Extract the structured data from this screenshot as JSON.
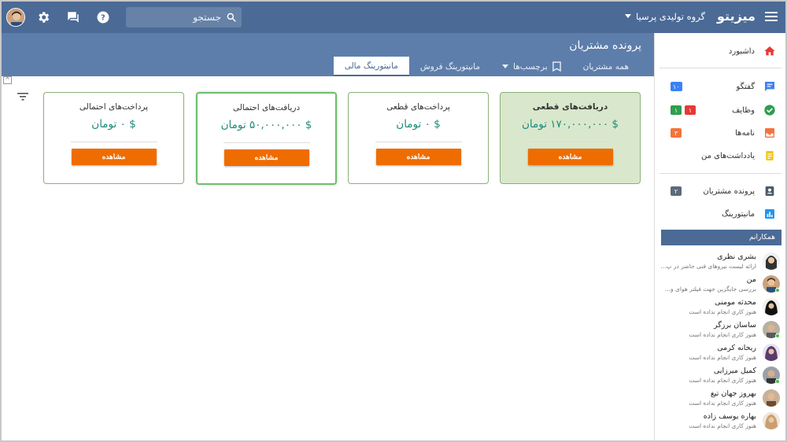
{
  "header": {
    "brand": "میزیتو",
    "org_name": "گروه تولیدی پرسیا",
    "search_placeholder": "جستجو"
  },
  "subheader": {
    "page_title": "پرونده مشتریان",
    "tabs": [
      {
        "label": "همه مشتریان"
      },
      {
        "label": "برچسب‌ها"
      },
      {
        "label": "مانیتورینگ فروش"
      },
      {
        "label": "مانیتورینگ مالی"
      }
    ]
  },
  "cards": [
    {
      "title": "دریافت‌های قطعی",
      "amount": "$ ۱۷۰,۰۰۰,۰۰۰ تومان",
      "button": "مشاهده"
    },
    {
      "title": "پرداخت‌های قطعی",
      "amount": "$ ۰ تومان",
      "button": "مشاهده"
    },
    {
      "title": "دریافت‌های احتمالی",
      "amount": "$ ۵۰,۰۰۰,۰۰۰ تومان",
      "button": "مشاهده"
    },
    {
      "title": "پرداخت‌های احتمالی",
      "amount": "$ ۰ تومان",
      "button": "مشاهده"
    }
  ],
  "sidebar": {
    "nav": [
      {
        "label": "داشبورد",
        "icon": "home-icon"
      },
      {
        "label": "گفتگو",
        "icon": "chat-icon",
        "badges": [
          {
            "text": "۱۰",
            "color": "#3b82f6"
          }
        ]
      },
      {
        "label": "وظایف",
        "icon": "check-circle-icon",
        "badges": [
          {
            "text": "۱",
            "color": "#2e9e4f"
          },
          {
            "text": "۱",
            "color": "#e53935"
          }
        ]
      },
      {
        "label": "نامه‌ها",
        "icon": "inbox-icon",
        "badges": [
          {
            "text": "۳",
            "color": "#f4733b"
          }
        ]
      },
      {
        "label": "یادداشت‌های من",
        "icon": "note-icon"
      },
      {
        "label": "پرونده مشتریان",
        "icon": "contacts-icon",
        "badges": [
          {
            "text": "۲",
            "color": "#5a6b7c"
          }
        ]
      },
      {
        "label": "مانیتورینگ",
        "icon": "bar-chart-icon"
      }
    ],
    "colleagues_title": "همکارانم",
    "colleagues": [
      {
        "name": "بشری نظری",
        "status": "ارائه لیست نیروهای فنی حاضر در پ..."
      },
      {
        "name": "من",
        "status": "بررسی جایگزین جهت فیلتر هوای و..."
      },
      {
        "name": "محدثه مومنی",
        "status": "هنوز کاری انجام نداده است"
      },
      {
        "name": "ساسان برزگر",
        "status": "هنوز کاری انجام نداده است"
      },
      {
        "name": "ریحانه کرمی",
        "status": "هنوز کاری انجام نداده است"
      },
      {
        "name": "کمیل میرزایی",
        "status": "هنوز کاری انجام نداده است"
      },
      {
        "name": "بهروز جهان تیغ",
        "status": "هنوز کاری انجام نداده است"
      },
      {
        "name": "بهاره یوسف زاده",
        "status": "هنوز کاری انجام نداده است"
      }
    ]
  },
  "colors": {
    "header": "#4b6a96",
    "subheader": "#5d7eab",
    "accent_button": "#ef6c00",
    "amount_text": "#1f8a7a",
    "highlight_card": "#d9e8cc"
  }
}
